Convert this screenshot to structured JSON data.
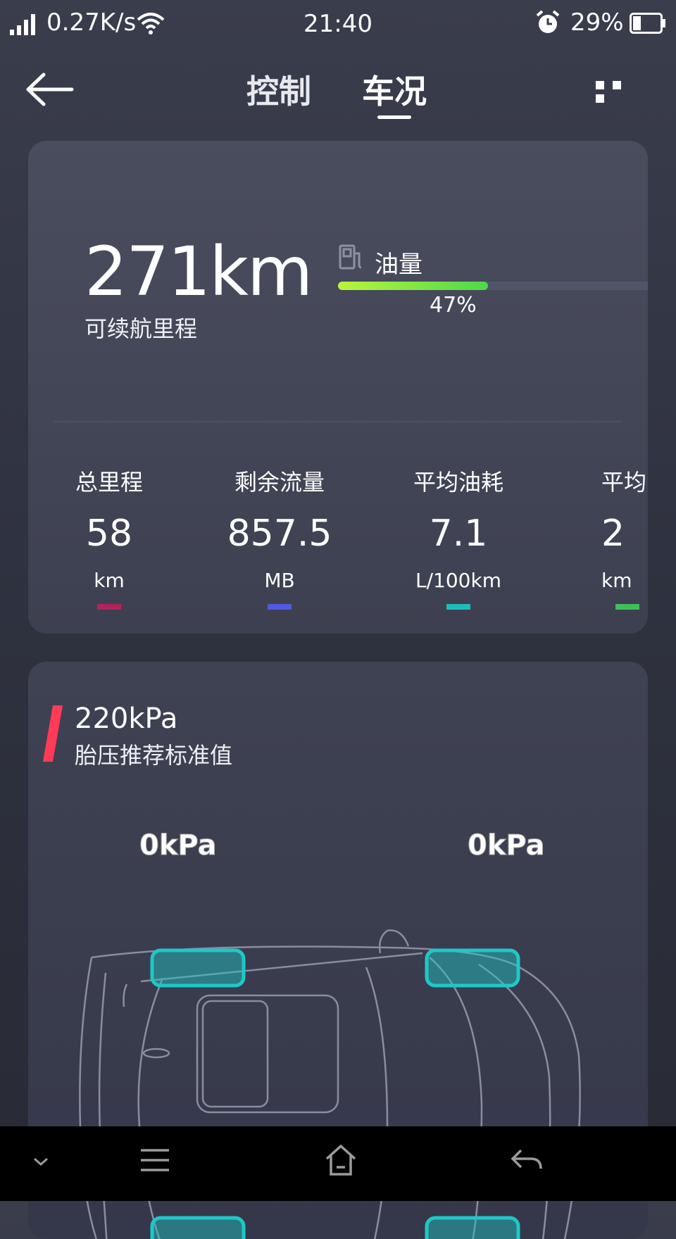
{
  "status_bar": {
    "network_speed": "0.27K/s",
    "time": "21:40",
    "battery_percent": "29%",
    "battery_level": 0.29,
    "icons": [
      "signal-icon",
      "wifi-icon",
      "alarm-icon",
      "battery-icon"
    ]
  },
  "nav": {
    "tabs": [
      {
        "label": "控制",
        "active": false
      },
      {
        "label": "车况",
        "active": true
      }
    ],
    "icons": [
      "back-arrow-icon",
      "more-dots-icon"
    ]
  },
  "overview": {
    "range_value": "271km",
    "range_label": "可续航里程",
    "fuel_label": "油量",
    "fuel_percent_text": "47%",
    "fuel_level": 0.47,
    "fuel_gradient": [
      "#b9f53d",
      "#4dd84a"
    ],
    "stats": [
      {
        "label": "总里程",
        "value": "58",
        "unit": "km",
        "color": "#b3245a"
      },
      {
        "label": "剩余流量",
        "value": "857.5",
        "unit": "MB",
        "color": "#5059e6"
      },
      {
        "label": "平均油耗",
        "value": "7.1",
        "unit": "L/100km",
        "color": "#1dbdbd"
      },
      {
        "label": "平均",
        "value": "2",
        "unit": "km",
        "color": "#3fbf5a"
      }
    ]
  },
  "tire": {
    "recommended_value": "220kPa",
    "recommended_label": "胎压推荐标准值",
    "accent_color": "#ff3b57",
    "front_left": "0kPa",
    "front_right": "0kPa",
    "tire_color": "#1ec8c8"
  },
  "bottom_nav": {
    "icons": [
      "chevron-down-icon",
      "menu-icon",
      "home-icon",
      "return-icon"
    ]
  }
}
